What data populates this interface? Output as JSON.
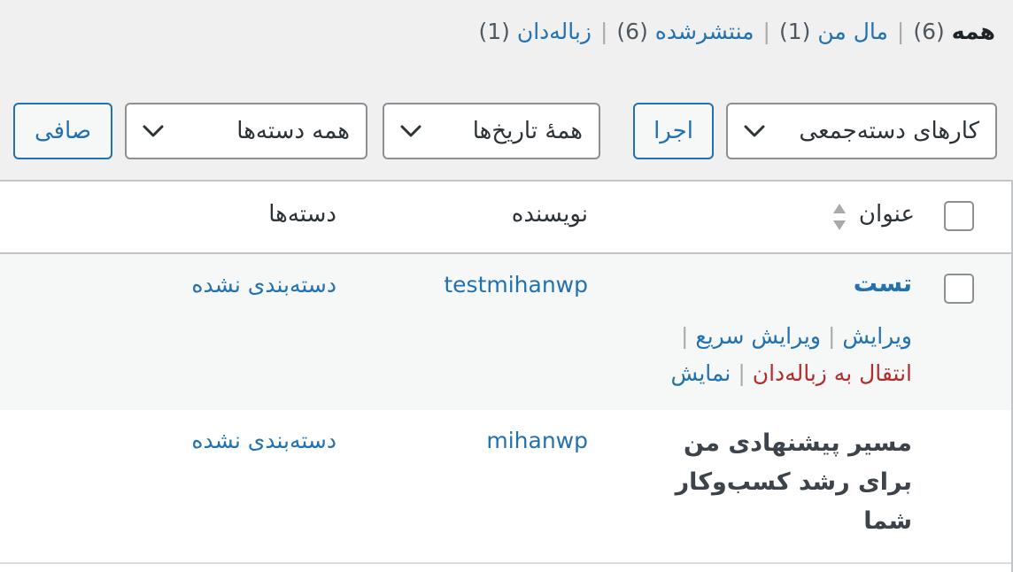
{
  "filters_nav": {
    "all_label": "همه",
    "all_count": "(6)",
    "mine_label": "مال من",
    "mine_count": "(1)",
    "published_label": "منتشرشده",
    "published_count": "(6)",
    "trash_label": "زباله‌دان",
    "trash_count": "(1)"
  },
  "toolbar": {
    "bulk_actions_value": "کارهای دسته‌جمعی",
    "apply_label": "اجرا",
    "dates_value": "همهٔ تاریخ‌ها",
    "categories_value": "همه دسته‌ها",
    "filter_label": "صافی"
  },
  "table": {
    "columns": {
      "title": "عنوان",
      "author": "نویسنده",
      "categories": "دسته‌ها"
    },
    "rows": [
      {
        "title": "تست",
        "author": "testmihanwp",
        "categories": "دسته‌بندی نشده",
        "actions": {
          "edit": "ویرایش",
          "quick_edit": "ویرایش سریع",
          "trash": "انتقال به زباله‌دان",
          "view": "نمایش"
        }
      },
      {
        "title": "مسیر پیشنهادی من برای رشد کسب‌وکار شما",
        "author": "mihanwp",
        "categories": "دسته‌بندی نشده"
      }
    ]
  },
  "colors": {
    "link": "#2271b1",
    "danger": "#b32d2e",
    "background": "#f0f0f1"
  }
}
